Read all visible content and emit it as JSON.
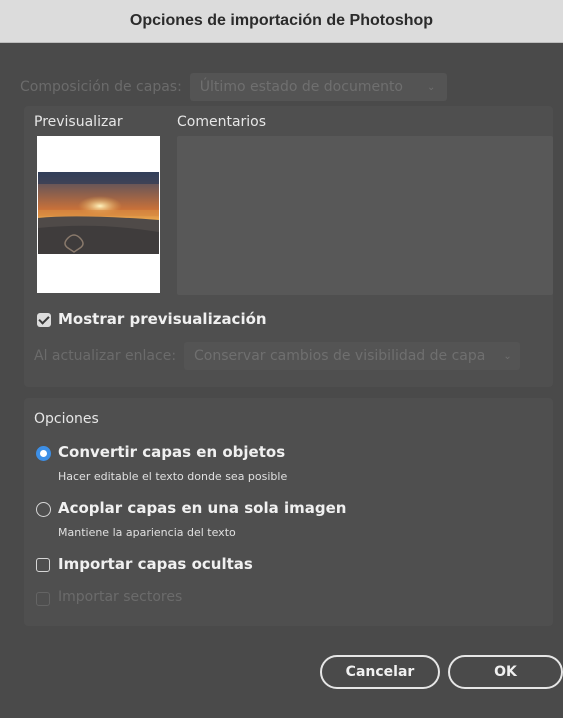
{
  "dialog": {
    "title": "Opciones de importación de Photoshop",
    "layer_comp": {
      "label": "Composición de capas:",
      "value": "Último estado de documento"
    },
    "preview_label": "Previsualizar",
    "comments_label": "Comentarios",
    "show_preview": {
      "label": "Mostrar previsualización",
      "checked": true
    },
    "update_link": {
      "label": "Al actualizar enlace:",
      "value": "Conservar cambios de visibilidad de capa"
    },
    "options": {
      "heading": "Opciones",
      "convert_layers": {
        "label": "Convertir capas en objetos",
        "sublabel": "Hacer editable el texto donde sea posible",
        "selected": true
      },
      "flatten_layers": {
        "label": "Acoplar capas en una sola imagen",
        "sublabel": "Mantiene la apariencia del texto",
        "selected": false
      },
      "import_hidden": {
        "label": "Importar capas ocultas",
        "checked": false
      },
      "import_slices": {
        "label": "Importar sectores",
        "checked": false,
        "disabled": true
      }
    },
    "buttons": {
      "cancel": "Cancelar",
      "ok": "OK"
    }
  },
  "colors": {
    "dialog_bg": "#4a4a4a",
    "titlebar_bg": "#dcdcdc",
    "radio_accent": "#3d8fe6"
  }
}
